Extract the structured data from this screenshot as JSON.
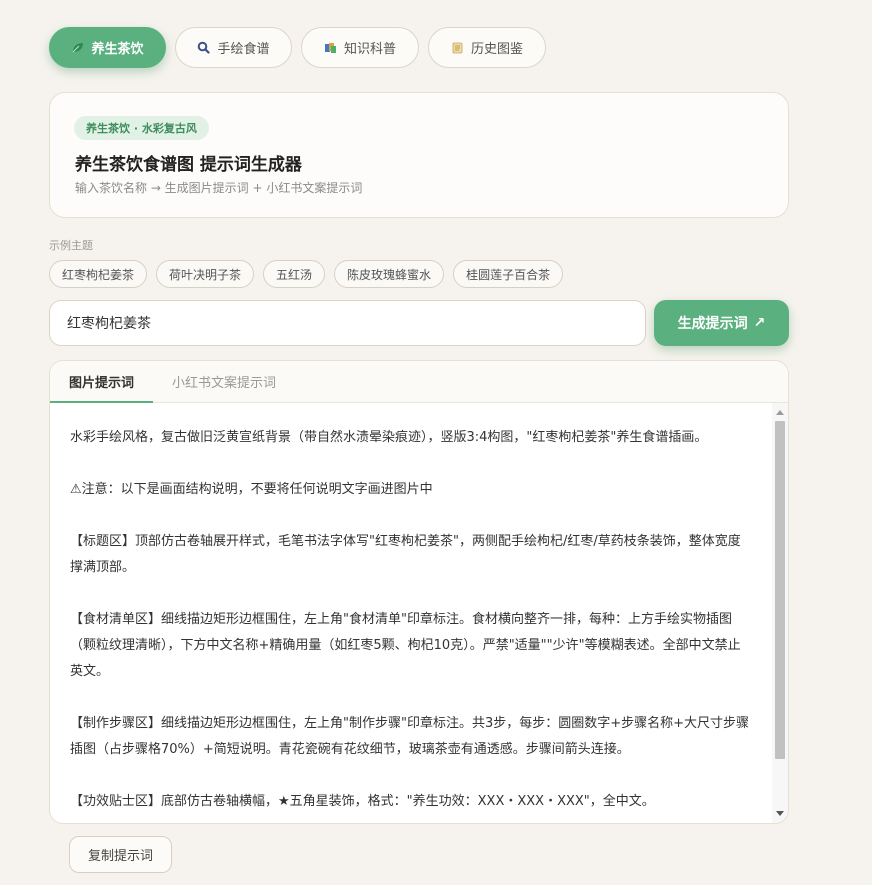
{
  "top_tabs": [
    {
      "label": "养生茶饮",
      "icon": "leaf-icon",
      "active": true
    },
    {
      "label": "手绘食谱",
      "icon": "search-icon",
      "active": false
    },
    {
      "label": "知识科普",
      "icon": "books-icon",
      "active": false
    },
    {
      "label": "历史图鉴",
      "icon": "scroll-icon",
      "active": false
    }
  ],
  "hero": {
    "badge": "养生茶饮 · 水彩复古风",
    "title": "养生茶饮食谱图 提示词生成器",
    "subtitle": "输入茶饮名称 → 生成图片提示词 + 小红书文案提示词"
  },
  "examples": {
    "label": "示例主题",
    "chips": [
      "红枣枸杞姜茶",
      "荷叶决明子茶",
      "五红汤",
      "陈皮玫瑰蜂蜜水",
      "桂圆莲子百合茶"
    ]
  },
  "input": {
    "value": "红枣枸杞姜茶"
  },
  "generate_button": {
    "label": "生成提示词",
    "arrow": "↗"
  },
  "output": {
    "tabs": [
      "图片提示词",
      "小红书文案提示词"
    ],
    "paragraphs": [
      "水彩手绘风格，复古做旧泛黄宣纸背景（带自然水渍晕染痕迹），竖版3:4构图，\"红枣枸杞姜茶\"养生食谱插画。",
      "⚠注意：以下是画面结构说明，不要将任何说明文字画进图片中",
      "【标题区】顶部仿古卷轴展开样式，毛笔书法字体写\"红枣枸杞姜茶\"，两侧配手绘枸杞/红枣/草药枝条装饰，整体宽度撑满顶部。",
      "【食材清单区】细线描边矩形边框围住，左上角\"食材清单\"印章标注。食材横向整齐一排，每种：上方手绘实物插图（颗粒纹理清晰），下方中文名称+精确用量（如红枣5颗、枸杞10克）。严禁\"适量\"\"少许\"等模糊表述。全部中文禁止英文。",
      "【制作步骤区】细线描边矩形边框围住，左上角\"制作步骤\"印章标注。共3步，每步：圆圈数字+步骤名称+大尺寸步骤插图（占步骤格70%）+简短说明。青花瓷碗有花纹细节，玻璃茶壶有通透感。步骤间箭头连接。",
      "【功效贴士区】底部仿古卷轴横幅，★五角星装饰，格式：\"养生功效：XXX・XXX・XXX\"，全中文。"
    ]
  },
  "copy_button": {
    "label": "复制提示词"
  },
  "colors": {
    "accent": "#5bb07f",
    "background": "#f6f3ee"
  }
}
